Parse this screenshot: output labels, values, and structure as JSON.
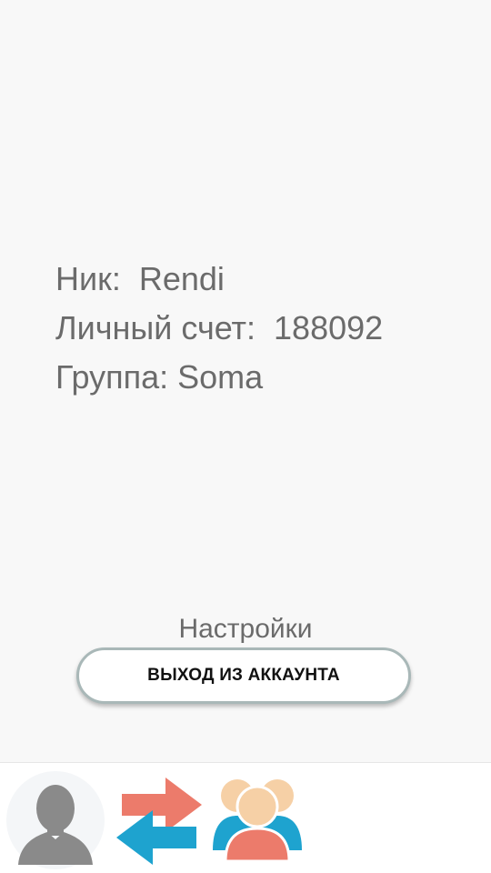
{
  "profile": {
    "nick_line": "Ник:  Rendi",
    "account_line": "Личный счет:  188092",
    "group_line": "Группа: Soma"
  },
  "settings": {
    "label": "Настройки"
  },
  "logout": {
    "label": "ВЫХОД ИЗ АККАУНТА"
  },
  "bottom_nav": {
    "items": [
      {
        "icon": "user-avatar-icon"
      },
      {
        "icon": "transfer-arrows-icon"
      },
      {
        "icon": "group-people-icon"
      }
    ]
  },
  "colors": {
    "background": "#f8f8f8",
    "text": "#6b6b6b",
    "button_border": "#a9b8b8",
    "arrow_red": "#ec7b6b",
    "arrow_blue": "#1ea3cf",
    "avatar_gray": "#8a8a8a"
  }
}
